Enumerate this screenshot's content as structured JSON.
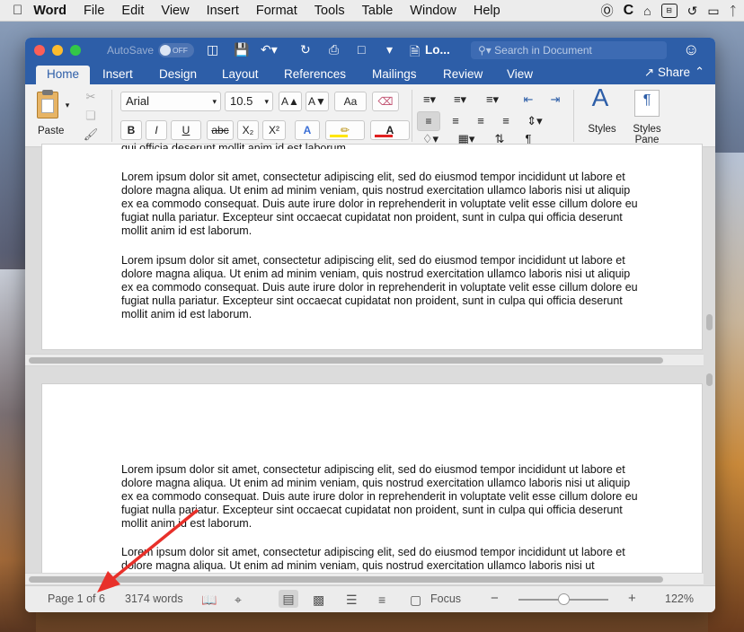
{
  "menubar": {
    "apple": "",
    "app": "Word",
    "items": [
      "File",
      "Edit",
      "View",
      "Insert",
      "Format",
      "Tools",
      "Table",
      "Window",
      "Help"
    ],
    "icons": [
      "vpn-icon",
      "c-icon",
      "home-icon",
      "window-switcher-icon",
      "history-icon",
      "airplay-icon",
      "bluetooth-icon"
    ]
  },
  "window": {
    "autosave_label": "AutoSave",
    "autosave_state": "OFF",
    "doc_title": "Lo...",
    "search_placeholder": "Search in Document"
  },
  "tabs": {
    "items": [
      "Home",
      "Insert",
      "Design",
      "Layout",
      "References",
      "Mailings",
      "Review",
      "View"
    ],
    "active": "Home",
    "share": "Share"
  },
  "ribbon": {
    "paste": "Paste",
    "font": "Arial",
    "size": "10.5",
    "styles": "Styles",
    "styles_pane_1": "Styles",
    "styles_pane_2": "Pane",
    "bold": "B",
    "italic": "I",
    "underline": "U",
    "strike": "abc",
    "subscript": "X₂",
    "superscript": "X²",
    "grow": "A▲",
    "shrink": "A▼",
    "case": "Aa",
    "text_effects": "A",
    "font_color": "A",
    "pilcrow": "¶"
  },
  "page1": {
    "cut_line": "qui officia deserunt mollit anim id est laborum.",
    "paragraphs": [
      "Lorem ipsum dolor sit amet, consectetur adipiscing elit, sed do eiusmod tempor incididunt ut labore et dolore magna aliqua. Ut enim ad minim veniam, quis nostrud exercitation ullamco laboris nisi ut aliquip ex ea commodo consequat. Duis aute irure dolor in reprehenderit in voluptate velit esse cillum dolore eu fugiat nulla pariatur. Excepteur sint occaecat cupidatat non proident, sunt in culpa qui officia deserunt mollit anim id est laborum.",
      "Lorem ipsum dolor sit amet, consectetur adipiscing elit, sed do eiusmod tempor incididunt ut labore et dolore magna aliqua. Ut enim ad minim veniam, quis nostrud exercitation ullamco laboris nisi ut aliquip ex ea commodo consequat. Duis aute irure dolor in reprehenderit in voluptate velit esse cillum dolore eu fugiat nulla pariatur. Excepteur sint occaecat cupidatat non proident, sunt in culpa qui officia deserunt mollit anim id est laborum."
    ]
  },
  "page2": {
    "paragraphs": [
      "Lorem ipsum dolor sit amet, consectetur adipiscing elit, sed do eiusmod tempor incididunt ut labore et dolore magna aliqua. Ut enim ad minim veniam, quis nostrud exercitation ullamco laboris nisi ut aliquip ex ea commodo consequat. Duis aute irure dolor in reprehenderit in voluptate velit esse cillum dolore eu fugiat nulla pariatur. Excepteur sint occaecat cupidatat non proident, sunt in culpa qui officia deserunt mollit anim id est laborum.",
      "Lorem ipsum dolor sit amet, consectetur adipiscing elit, sed do eiusmod tempor incididunt ut labore et dolore magna aliqua. Ut enim ad minim veniam, quis nostrud exercitation ullamco laboris nisi ut"
    ]
  },
  "status": {
    "page": "Page 1 of 6",
    "words": "3174 words",
    "focus": "Focus",
    "zoom": "122%",
    "zoom_minus": "−",
    "zoom_plus": "+"
  },
  "colors": {
    "accent": "#2d5ea8",
    "arrow": "#e8302a",
    "highlight": "#ffe600",
    "font_color": "#e02020"
  }
}
